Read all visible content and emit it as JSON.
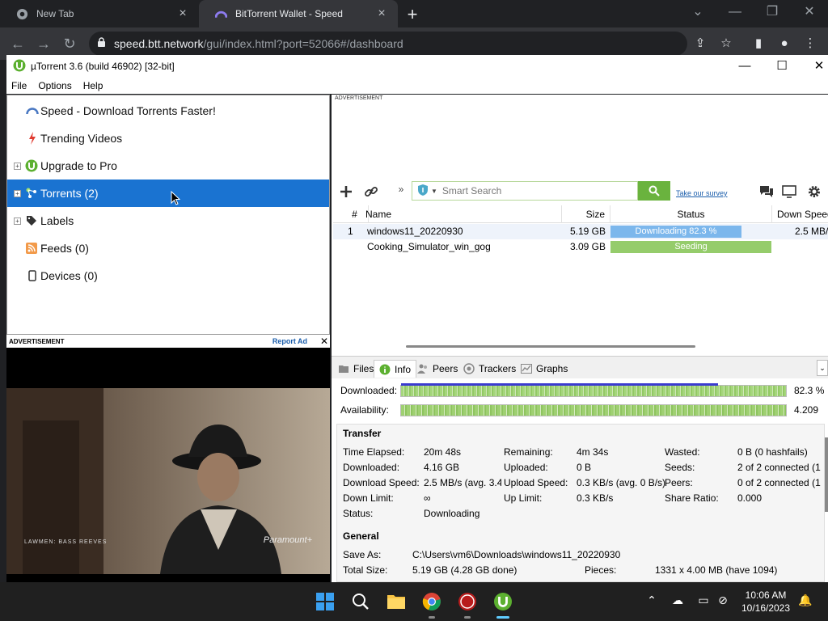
{
  "browser": {
    "tabs": [
      {
        "label": "New Tab",
        "active": false
      },
      {
        "label": "BitTorrent Wallet - Speed",
        "active": true
      }
    ],
    "url_host": "speed.btt.network",
    "url_path": "/gui/index.html?port=52066#/dashboard"
  },
  "app": {
    "title": "µTorrent 3.6  (build 46902) [32-bit]",
    "menu": [
      "File",
      "Options",
      "Help"
    ]
  },
  "sidebar": {
    "items": [
      {
        "label": "Speed - Download Torrents Faster!",
        "icon": "speed-gauge-icon"
      },
      {
        "label": "Trending Videos",
        "icon": "lightning-icon"
      },
      {
        "label": "Upgrade to Pro",
        "icon": "utorrent-logo-icon"
      },
      {
        "label": "Torrents (2)",
        "icon": "torrents-icon"
      },
      {
        "label": "Labels",
        "icon": "tag-icon"
      },
      {
        "label": "Feeds (0)",
        "icon": "rss-icon"
      },
      {
        "label": "Devices (0)",
        "icon": "device-icon"
      }
    ]
  },
  "ad_left": {
    "header": "ADVERTISEMENT",
    "report": "Report Ad",
    "caption": "LAWMEN: BASS REEVES",
    "brand": "Paramount+"
  },
  "ad_top": {
    "header": "ADVERTISEMENT"
  },
  "toolbar": {
    "search_placeholder": "Smart Search",
    "survey": "Take our survey",
    "more": "»"
  },
  "torrent_list": {
    "columns": [
      "#",
      "Name",
      "Size",
      "Status",
      "Down Speed"
    ],
    "rows": [
      {
        "num": "1",
        "name": "windows11_20220930",
        "size": "5.19 GB",
        "status": "Downloading 82.3 %",
        "progress": 0.823,
        "down_speed": "2.5 MB/"
      },
      {
        "num": "",
        "name": "Cooking_Simulator_win_gog",
        "size": "3.09 GB",
        "status": "Seeding",
        "progress": 1.0,
        "down_speed": ""
      }
    ]
  },
  "detail_tabs": [
    "Files",
    "Info",
    "Peers",
    "Trackers",
    "Graphs"
  ],
  "bars": {
    "downloaded_label": "Downloaded:",
    "downloaded_value": "82.3 %",
    "downloaded_progress": 0.823,
    "availability_label": "Availability:",
    "availability_value": "4.209"
  },
  "transfer": {
    "title": "Transfer",
    "time_elapsed_label": "Time Elapsed:",
    "time_elapsed": "20m 48s",
    "remaining_label": "Remaining:",
    "remaining": "4m 34s",
    "wasted_label": "Wasted:",
    "wasted": "0 B (0 hashfails)",
    "downloaded_label": "Downloaded:",
    "downloaded": "4.16 GB",
    "uploaded_label": "Uploaded:",
    "uploaded": "0 B",
    "seeds_label": "Seeds:",
    "seeds": "2 of 2 connected (1",
    "down_speed_label": "Download Speed:",
    "down_speed": "2.5 MB/s (avg. 3.4",
    "up_speed_label": "Upload Speed:",
    "up_speed": "0.3 KB/s (avg. 0 B/s)",
    "peers_label": "Peers:",
    "peers": "0 of 2 connected (1",
    "down_limit_label": "Down Limit:",
    "down_limit": "∞",
    "up_limit_label": "Up Limit:",
    "up_limit": "0.3 KB/s",
    "share_ratio_label": "Share Ratio:",
    "share_ratio": "0.000",
    "status_label": "Status:",
    "status": "Downloading"
  },
  "general": {
    "title": "General",
    "save_as_label": "Save As:",
    "save_as": "C:\\Users\\vm6\\Downloads\\windows11_20220930",
    "total_size_label": "Total Size:",
    "total_size": "5.19 GB (4.28 GB done)",
    "pieces_label": "Pieces:",
    "pieces": "1331 x 4.00 MB (have 1094)"
  },
  "taskbar": {
    "time": "10:06 AM",
    "date": "10/16/2023"
  },
  "colors": {
    "selection": "#1a73d1",
    "progress_blue": "#7cb7ec",
    "seeding_green": "#95cc6b",
    "utorrent_green": "#5cb030"
  }
}
